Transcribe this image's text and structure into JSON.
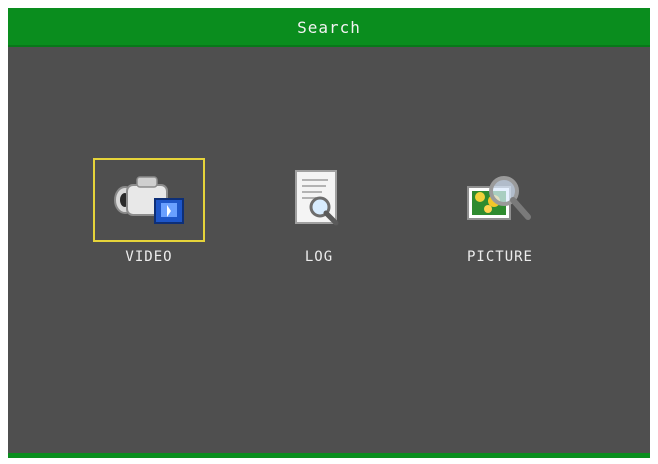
{
  "header": {
    "title": "Search"
  },
  "menu": {
    "items": [
      {
        "label": "VIDEO",
        "icon": "camcorder-icon",
        "selected": true
      },
      {
        "label": "LOG",
        "icon": "log-document-icon",
        "selected": false
      },
      {
        "label": "PICTURE",
        "icon": "picture-search-icon",
        "selected": false
      }
    ]
  },
  "colors": {
    "header_bg": "#0a8d1e",
    "screen_bg": "#4f4f4f",
    "selection_border": "#e6d43a",
    "text": "#ececec"
  }
}
